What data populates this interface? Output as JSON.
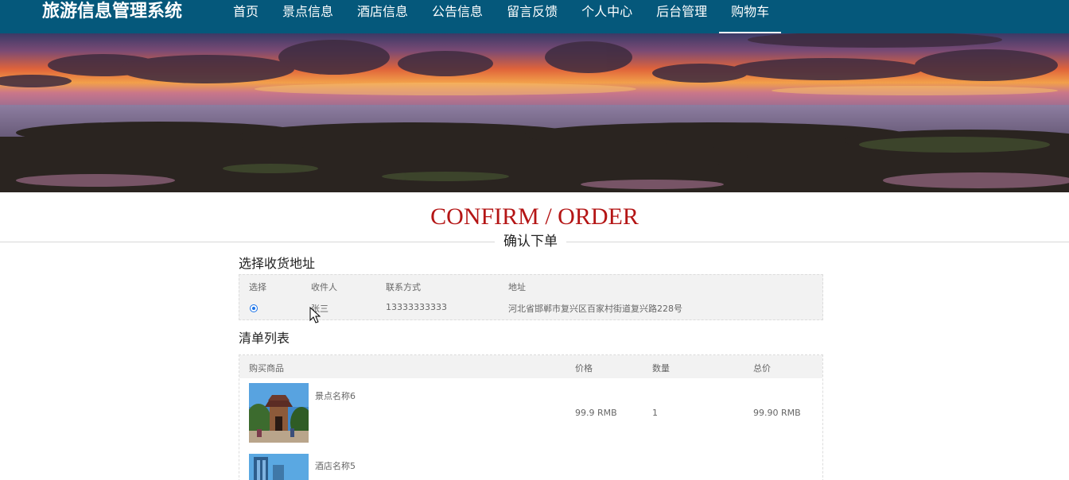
{
  "header": {
    "brand": "旅游信息管理系统",
    "nav": [
      "首页",
      "景点信息",
      "酒店信息",
      "公告信息",
      "留言反馈",
      "个人中心",
      "后台管理",
      "购物车"
    ],
    "active_nav": "购物车"
  },
  "section": {
    "title_en": "CONFIRM / ORDER",
    "title_cn": "确认下单"
  },
  "address": {
    "heading": "选择收货地址",
    "columns": [
      "选择",
      "收件人",
      "联系方式",
      "地址"
    ],
    "rows": [
      {
        "selected": true,
        "name": "张三",
        "phone": "13333333333",
        "address": "河北省邯郸市复兴区百家村街道复兴路228号"
      }
    ]
  },
  "order_list": {
    "heading": "清单列表",
    "columns": [
      "购买商品",
      "价格",
      "数量",
      "总价"
    ],
    "items": [
      {
        "name": "景点名称6",
        "price": "99.9 RMB",
        "qty": "1",
        "total": "99.90 RMB",
        "image": "scenic-gate-photo"
      },
      {
        "name": "酒店名称5",
        "price": "",
        "qty": "",
        "total": "",
        "image": "hotel-building-photo"
      }
    ]
  },
  "colors": {
    "topbar": "#05587b",
    "title_en": "#b41515",
    "radio": "#1a73e8"
  }
}
